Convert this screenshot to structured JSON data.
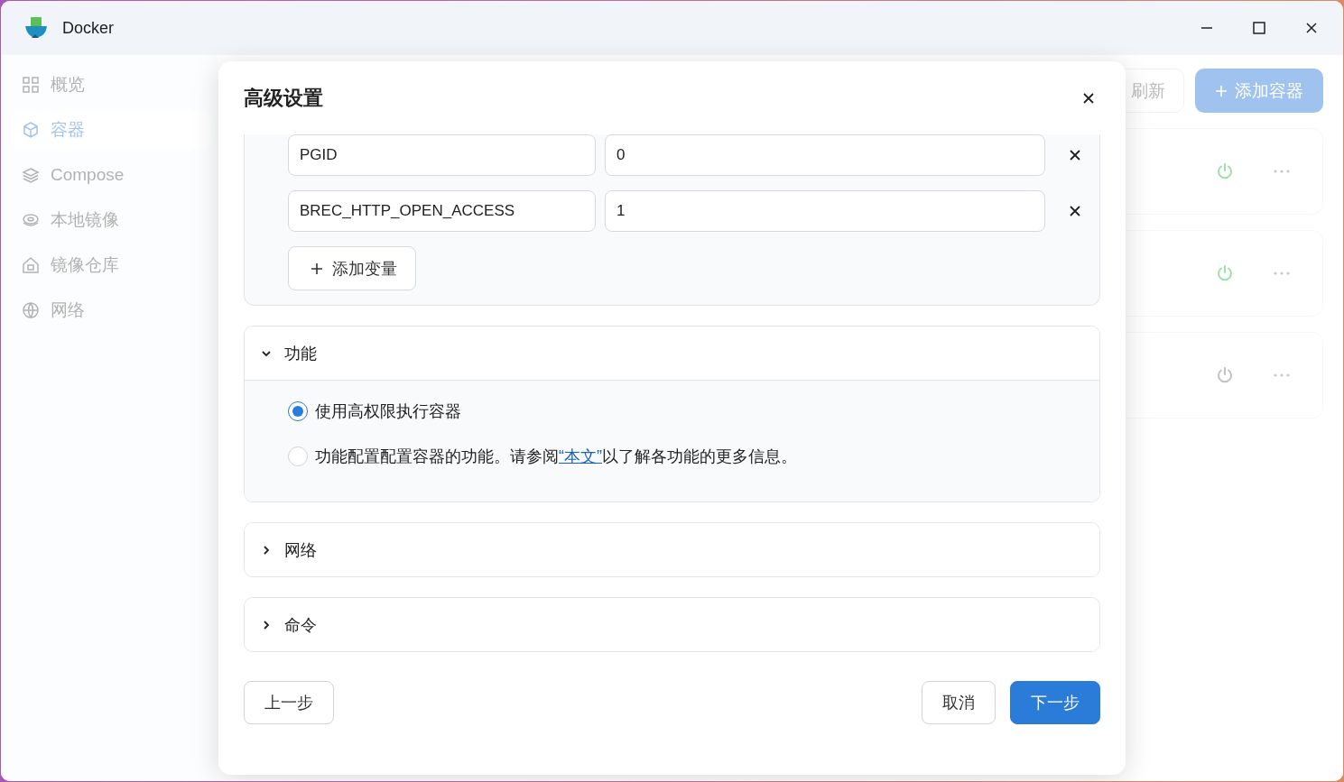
{
  "window": {
    "title": "Docker"
  },
  "sidebar": {
    "items": [
      {
        "label": "概览",
        "selected": false
      },
      {
        "label": "容器",
        "selected": true
      },
      {
        "label": "Compose",
        "selected": false
      },
      {
        "label": "本地镜像",
        "selected": false
      },
      {
        "label": "镜像仓库",
        "selected": false
      },
      {
        "label": "网络",
        "selected": false
      }
    ]
  },
  "toolbar": {
    "refresh": "刷新",
    "add": "添加容器"
  },
  "containers": [
    {
      "running": true
    },
    {
      "running": true
    },
    {
      "running": false
    }
  ],
  "dialog": {
    "title": "高级设置",
    "env": [
      {
        "name": "PGID",
        "value": "0"
      },
      {
        "name": "BREC_HTTP_OPEN_ACCESS",
        "value": "1"
      }
    ],
    "add_variable": "添加变量",
    "sections": [
      {
        "title": "功能",
        "expanded": true,
        "options": [
          {
            "label": "使用高权限执行容器",
            "selected": true
          },
          {
            "label": "功能配置配置容器的功能。请参阅",
            "link": "“本文”",
            "label_after": "以了解各功能的更多信息。",
            "selected": false
          }
        ]
      },
      {
        "title": "网络",
        "expanded": false
      },
      {
        "title": "命令",
        "expanded": false
      }
    ],
    "footer": {
      "back": "上一步",
      "cancel": "取消",
      "next": "下一步"
    }
  }
}
